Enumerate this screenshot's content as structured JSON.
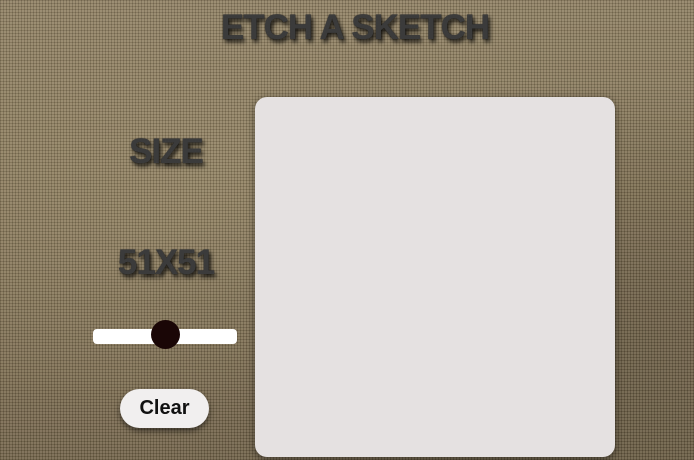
{
  "app": {
    "title": "ETCH A SKETCH"
  },
  "controls": {
    "size_label": "SIZE",
    "size_value": "51X51",
    "grid_size": 51,
    "slider_min": 1,
    "slider_max": 100,
    "clear_label": "Clear"
  },
  "colors": {
    "canvas_background": "#e5e1e1",
    "slider_track": "#ffffff",
    "slider_thumb": "#1a0606",
    "text": "#3b3b3b"
  }
}
